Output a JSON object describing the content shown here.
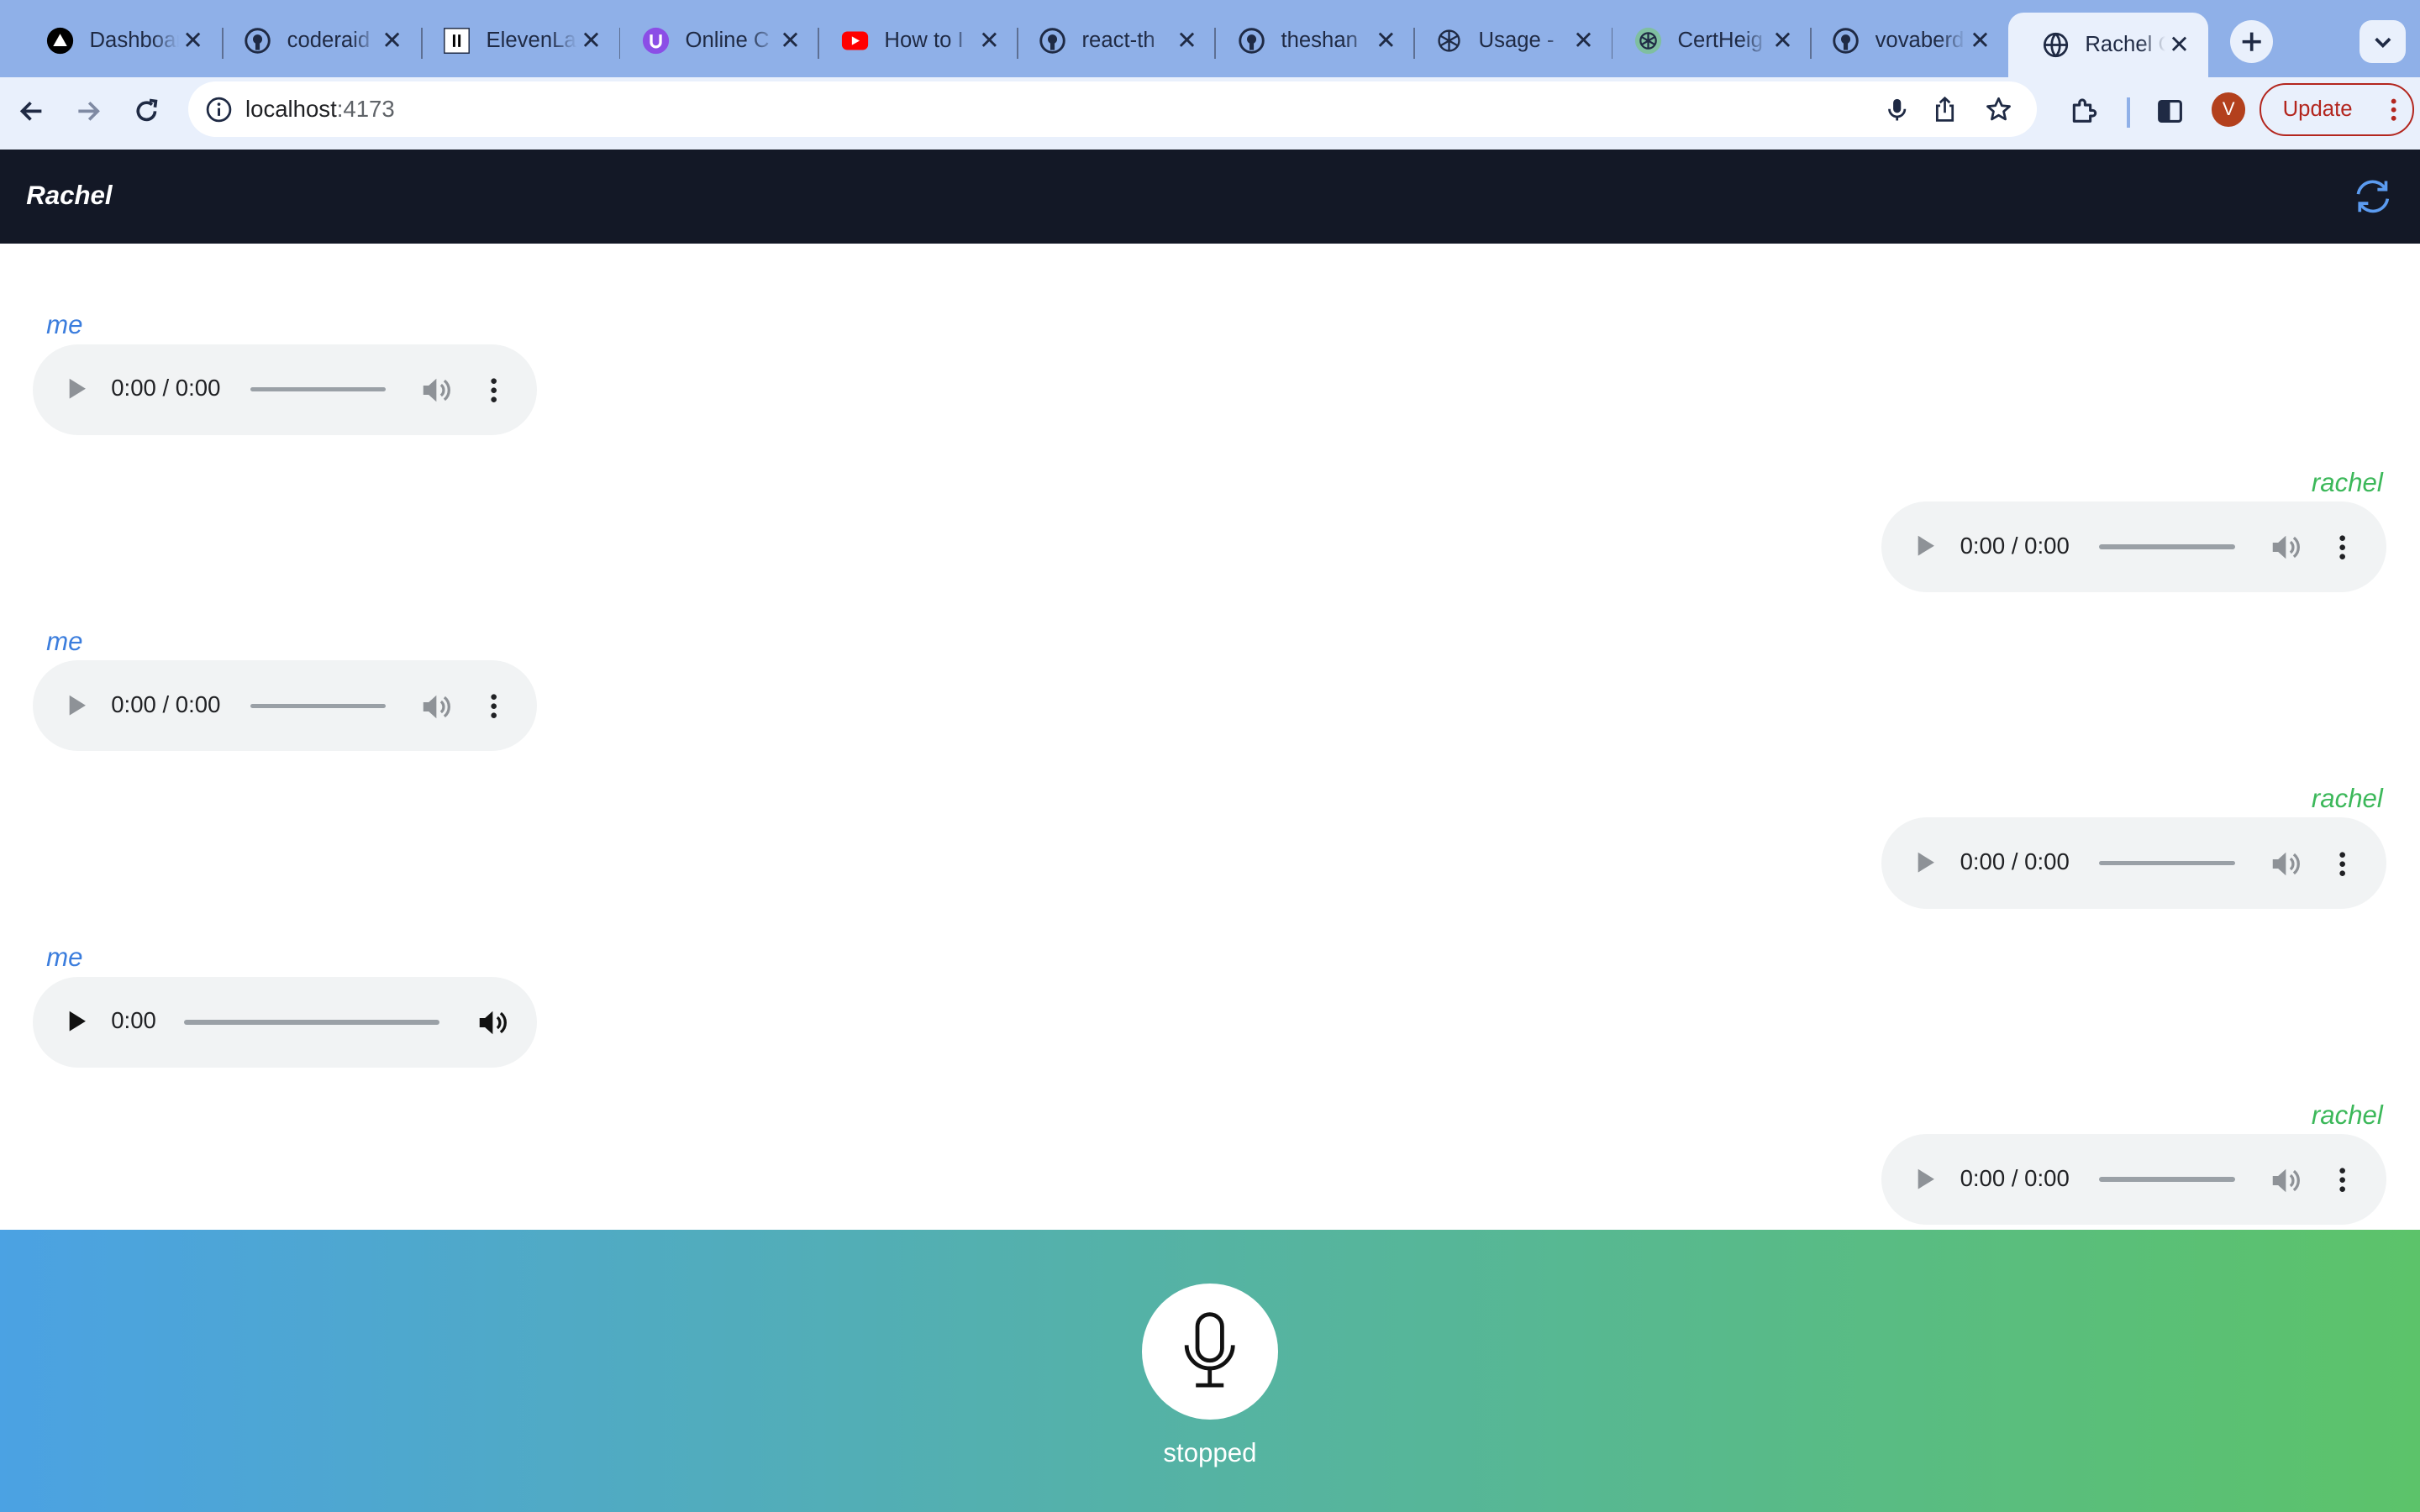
{
  "browser": {
    "tabs": [
      {
        "label": "Dashboard",
        "icon": "vercel-icon"
      },
      {
        "label": "coderaid",
        "icon": "github-icon"
      },
      {
        "label": "ElevenLabs",
        "icon": "elevenlabs-icon"
      },
      {
        "label": "Online C",
        "icon": "online-icon"
      },
      {
        "label": "How to I",
        "icon": "youtube-icon"
      },
      {
        "label": "react-th",
        "icon": "github-icon"
      },
      {
        "label": "theshan",
        "icon": "github-icon"
      },
      {
        "label": "Usage -",
        "icon": "openai-icon"
      },
      {
        "label": "CertHeig",
        "icon": "openai-icon"
      },
      {
        "label": "vovaberd",
        "icon": "github-icon"
      },
      {
        "label": "Rachel C",
        "icon": "globe-icon"
      }
    ],
    "address": {
      "host": "localhost",
      "port": ":4173"
    },
    "profile_initial": "V",
    "update_label": "Update"
  },
  "app": {
    "title": "Rachel",
    "status": "stopped"
  },
  "messages": [
    {
      "sender": "me",
      "time": "0:00 / 0:00"
    },
    {
      "sender": "rachel",
      "time": "0:00 / 0:00"
    },
    {
      "sender": "me",
      "time": "0:00 / 0:00"
    },
    {
      "sender": "rachel",
      "time": "0:00 / 0:00"
    },
    {
      "sender": "me",
      "time": "0:00"
    },
    {
      "sender": "rachel",
      "time": "0:00 / 0:00"
    }
  ],
  "colors": {
    "me_label": "#3b7ddd",
    "rachel_label": "#3cb85a",
    "header_bg": "#131826",
    "gradient_start": "#4ba2e3",
    "gradient_end": "#5cc36a"
  }
}
